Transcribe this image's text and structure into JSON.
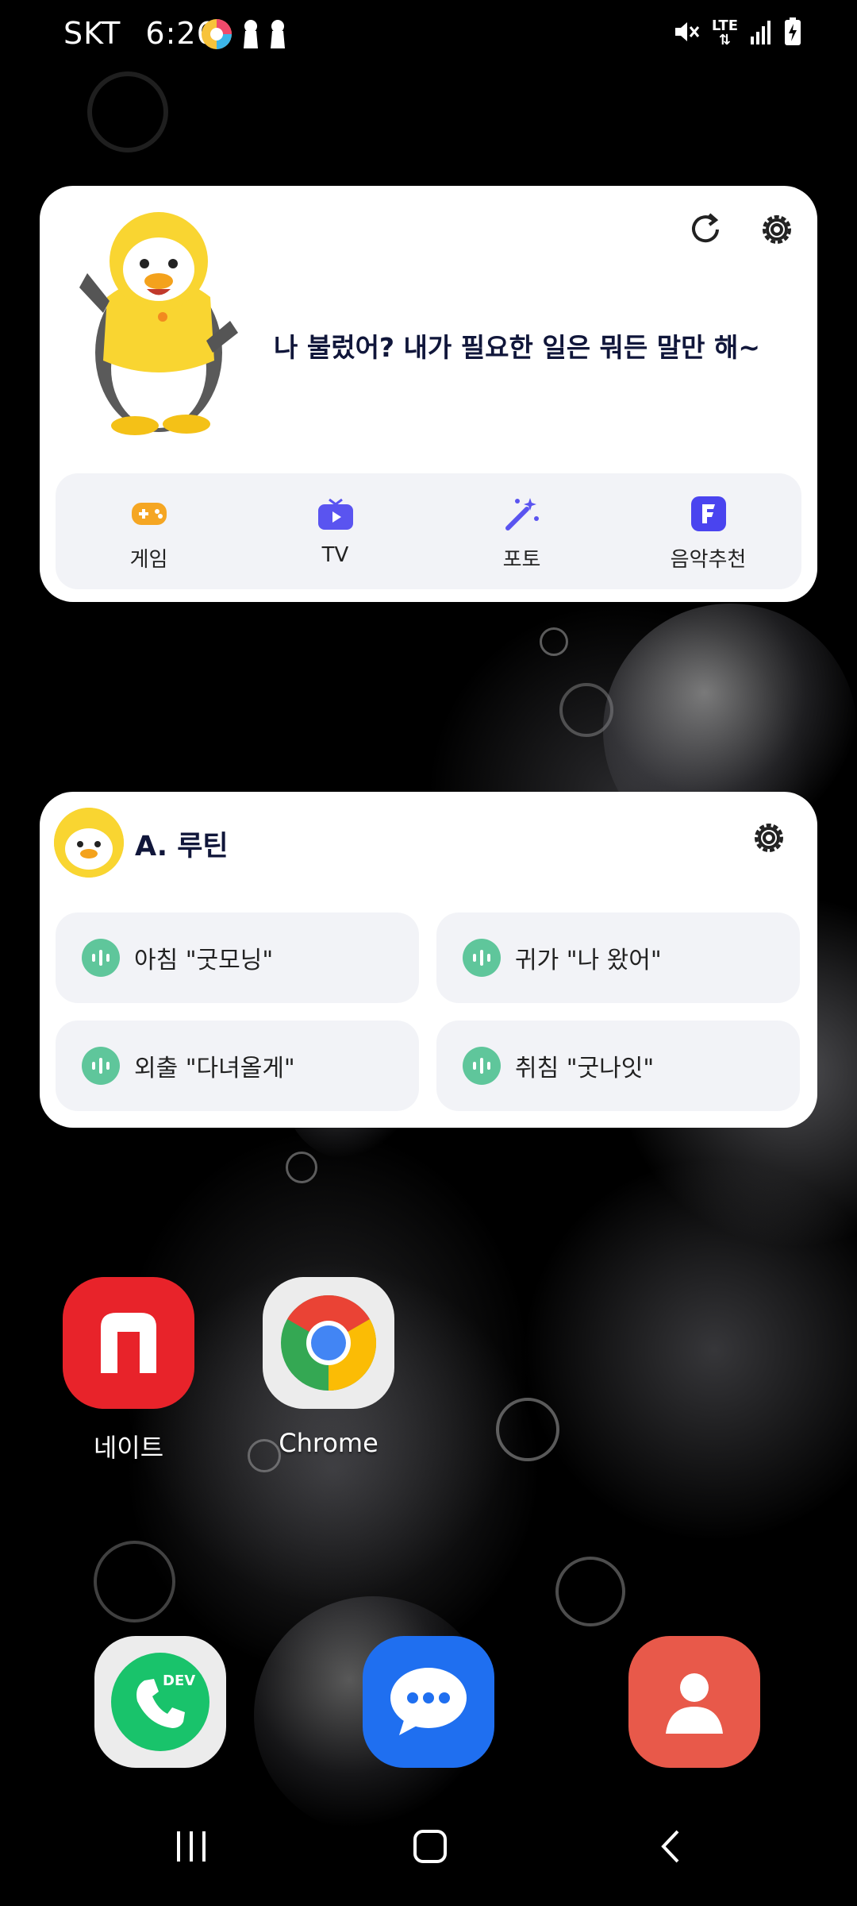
{
  "status_bar": {
    "carrier": "SKT",
    "time": "6:26",
    "network": "LTE",
    "icons": [
      "app-notification-icon",
      "keyhole-icon",
      "keyhole-icon",
      "mute-icon",
      "lte-icon",
      "signal-icon",
      "battery-charging-icon"
    ]
  },
  "assistant_widget": {
    "greeting": "나 불렀어? 내가 필요한 일은 뭐든 말만 해~",
    "quick_actions": [
      {
        "label": "게임",
        "icon": "gamepad-icon",
        "color": "#f5a623"
      },
      {
        "label": "TV",
        "icon": "tv-icon",
        "color": "#5a54f0"
      },
      {
        "label": "포토",
        "icon": "magic-wand-icon",
        "color": "#5a54f0"
      },
      {
        "label": "음악추천",
        "icon": "flo-music-icon",
        "color": "#4a44ef"
      }
    ]
  },
  "routine_widget": {
    "title": "A. 루틴",
    "items": [
      {
        "label": "아침 \"굿모닝\""
      },
      {
        "label": "귀가 \"나 왔어\""
      },
      {
        "label": "외출 \"다녀올게\""
      },
      {
        "label": "취침 \"굿나잇\""
      }
    ],
    "mic_color": "#5fc69b"
  },
  "home_apps": [
    {
      "label": "네이트",
      "icon": "nate-icon",
      "color": "#e8232a"
    },
    {
      "label": "Chrome",
      "icon": "chrome-icon",
      "color": "#ececec"
    }
  ],
  "dock": [
    {
      "label": "",
      "icon": "phone-dev-icon"
    },
    {
      "label": "",
      "icon": "messages-icon"
    },
    {
      "label": "",
      "icon": "contacts-icon"
    }
  ],
  "dock_badge": "DEV",
  "nav": {
    "recents": "recents-icon",
    "home": "home-icon",
    "back": "back-icon"
  }
}
